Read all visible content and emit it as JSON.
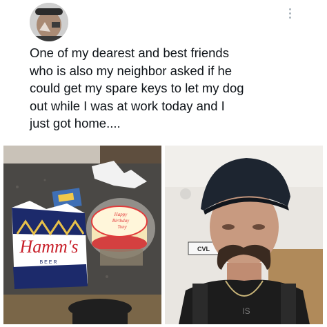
{
  "post": {
    "text": "One of my dearest and best friends\nwho is also my neighbor asked if he\ncould get my spare keys to let my dog\nout while I was at work today and I\njust got home....",
    "more_label": "⋮"
  },
  "avatar": {
    "icon": "user-avatar-photo"
  },
  "photos": {
    "left": {
      "cake_text_line1": "Happy",
      "cake_text_line2": "Birthday",
      "cake_text_line3": "Tony",
      "shirt_brand": "Hamm's",
      "shirt_sub": "BEER"
    },
    "right": {
      "sign_text": "CVL",
      "shirt_text": "IS"
    }
  },
  "colors": {
    "text": "#0f1419",
    "muted": "#aab4bc",
    "cake_frosting": "#e23a3a",
    "shirt_blue": "#1c2a6b"
  }
}
